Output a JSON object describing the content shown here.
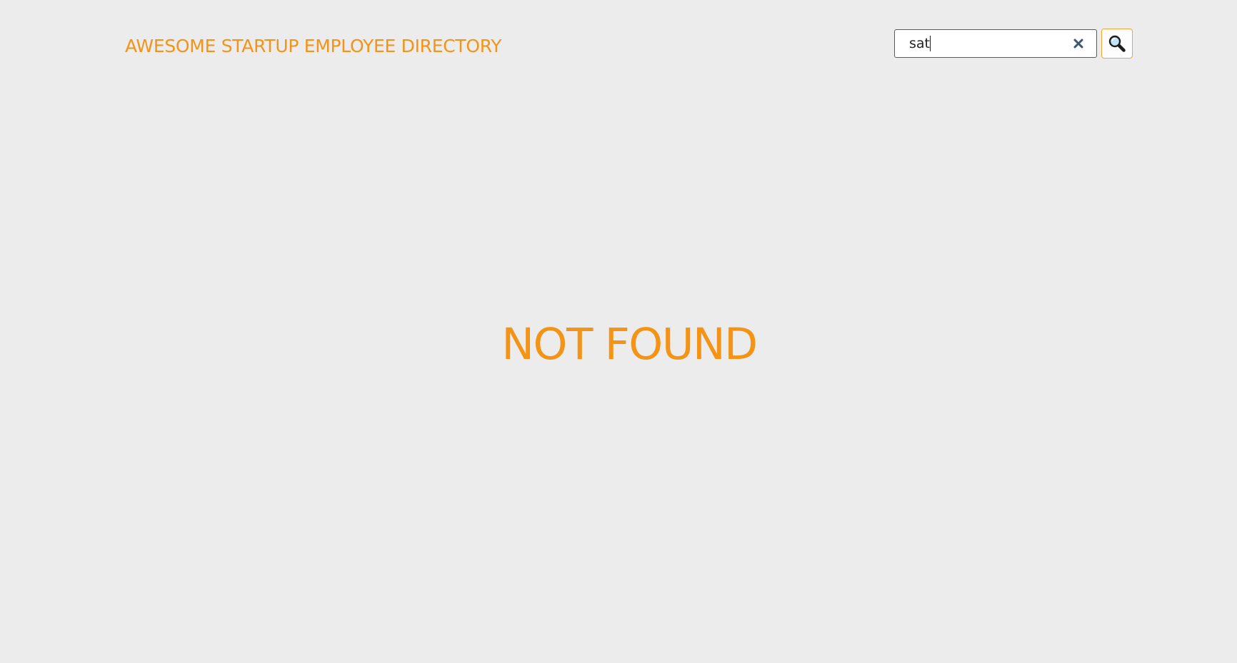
{
  "header": {
    "title": "AWESOME STARTUP EMPLOYEE DIRECTORY"
  },
  "search": {
    "value": "sat",
    "clear_icon": "close-icon",
    "button_icon": "search-icon"
  },
  "main": {
    "message": "NOT FOUND"
  },
  "colors": {
    "accent": "#f39417",
    "background": "#ececec",
    "clear_icon": "#3b5575"
  }
}
